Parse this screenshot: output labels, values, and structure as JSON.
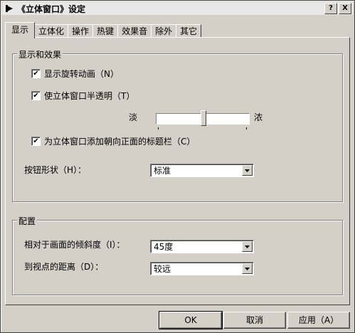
{
  "window": {
    "title": "《立体窗口》设定",
    "help_label": "?",
    "close_label": "X"
  },
  "tabs": [
    "显示",
    "立体化",
    "操作",
    "热键",
    "效果音",
    "除外",
    "其它"
  ],
  "display_group": {
    "title": "显示和效果",
    "rotate_animation": {
      "label": "显示旋转动画（N）",
      "checked": true
    },
    "translucent": {
      "label": "使立体窗口半透明（T）",
      "checked": true
    },
    "slider": {
      "low_label": "淡",
      "high_label": "浓",
      "value_fraction": 0.52
    },
    "titlebar_option": {
      "label": "为立体窗口添加朝向正面的标题栏（C）",
      "checked": true
    },
    "button_shape": {
      "label": "按钮形状（H）：",
      "value": "标准"
    }
  },
  "config_group": {
    "title": "配置",
    "tilt": {
      "label": "相对于画面的倾斜度（I）：",
      "value": "45度"
    },
    "distance": {
      "label": "到视点的距离（D）：",
      "value": "较远"
    }
  },
  "buttons": {
    "ok": "OK",
    "cancel": "取消",
    "apply": "应用（A）"
  },
  "check_glyph": "✔"
}
